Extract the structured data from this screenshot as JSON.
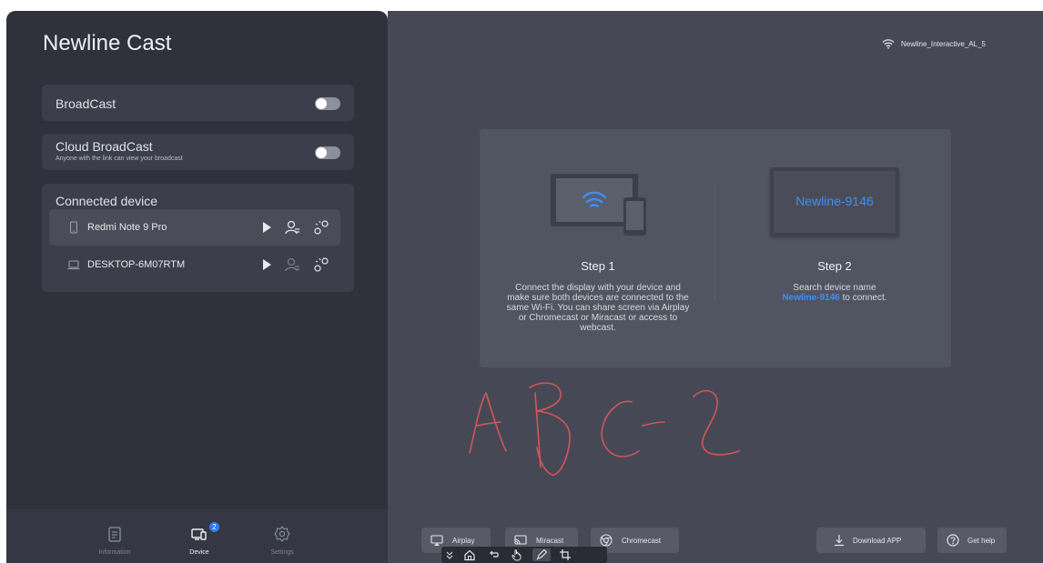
{
  "app": {
    "title": "Newline Cast"
  },
  "broadcast": {
    "label": "BroadCast",
    "enabled": false
  },
  "cloud_broadcast": {
    "label": "Cloud BroadCast",
    "subtitle": "Anyone with the link can view your broadcast",
    "enabled": false
  },
  "connected": {
    "title": "Connected device",
    "devices": [
      {
        "name": "Redmi Note 9 Pro",
        "type": "phone-icon",
        "selected": true
      },
      {
        "name": "DESKTOP-6M07RTM",
        "type": "laptop-icon",
        "selected": false
      }
    ]
  },
  "nav": {
    "items": [
      {
        "label": "Information",
        "icon": "clipboard-icon"
      },
      {
        "label": "Device",
        "icon": "device-icon",
        "badge": "2",
        "active": true
      },
      {
        "label": "Settings",
        "icon": "gear-icon"
      }
    ]
  },
  "network": {
    "name": "Newline_Interactive_AL_5",
    "icon": "wifi-icon"
  },
  "steps": {
    "step1": {
      "title": "Step 1",
      "text": "Connect the display with your device and make sure both devices are connected to the same Wi-Fi. You can share screen via Airplay or Chromecast or Miracast or access to webcast."
    },
    "step2": {
      "title": "Step 2",
      "device_name": "Newline-9146",
      "text_before": "Search device name",
      "text_highlight": "Newline-9146",
      "text_after": "to connect."
    }
  },
  "buttons": {
    "airplay": "Airplay",
    "miracast": "Miracast",
    "chromecast": "Chromecast",
    "download": "Download APP",
    "help": "Get help"
  },
  "toolbar": {
    "tools": [
      "collapse-icon",
      "home-icon",
      "undo-icon",
      "hand-icon",
      "pen-icon",
      "crop-icon"
    ],
    "active_tool": "pen-icon"
  },
  "colors": {
    "panel_bg": "#2f323d",
    "main_bg": "#464955",
    "card_bg": "#3c3f4b",
    "accent_blue": "#3e8ff5",
    "ink_red": "#d4545a"
  }
}
